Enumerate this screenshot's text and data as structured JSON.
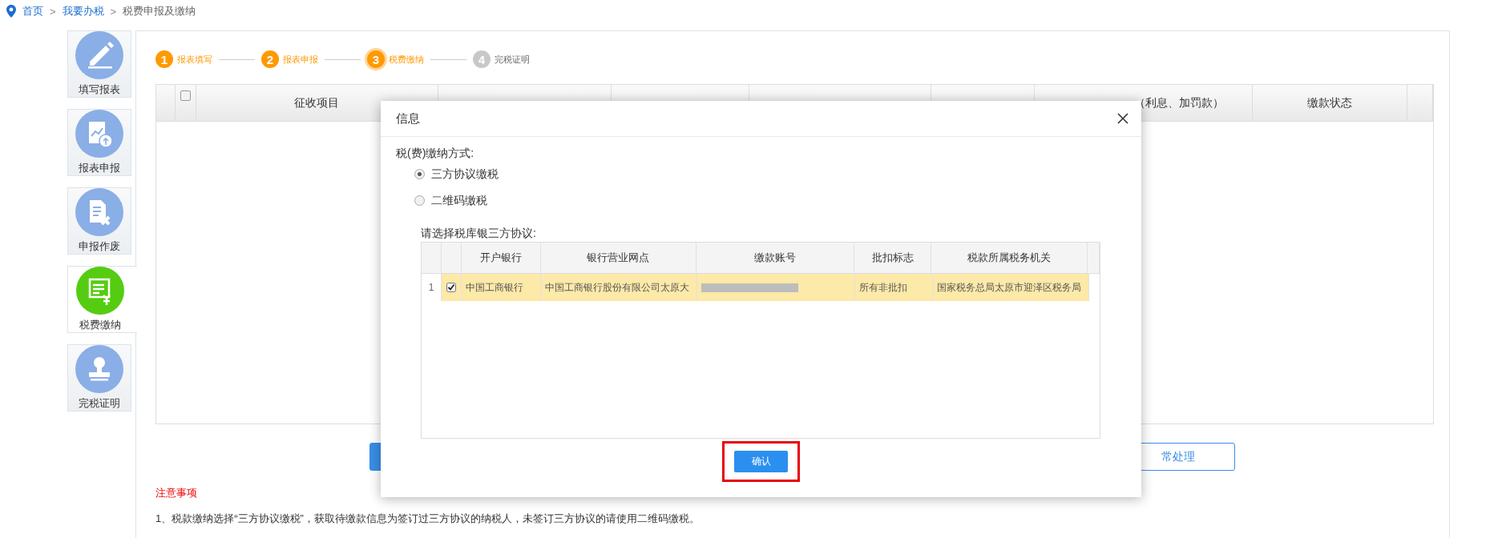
{
  "breadcrumb": [
    {
      "kind": "link",
      "label": "首页"
    },
    {
      "kind": "separator",
      "label": ">"
    },
    {
      "kind": "link",
      "label": "我要办税"
    },
    {
      "kind": "separator",
      "label": ">"
    },
    {
      "kind": "current",
      "label": "税费申报及缴纳"
    }
  ],
  "sidebar": {
    "items": [
      {
        "label": "填写报表",
        "selected": false
      },
      {
        "label": "报表申报",
        "selected": false
      },
      {
        "label": "申报作废",
        "selected": false
      },
      {
        "label": "税费缴纳",
        "selected": true
      },
      {
        "label": "完税证明",
        "selected": false
      }
    ]
  },
  "stepper": {
    "steps": [
      {
        "number": "1",
        "label": "报表填写",
        "done": true,
        "selected": false
      },
      {
        "number": "2",
        "label": "报表申报",
        "done": true,
        "selected": false
      },
      {
        "number": "3",
        "label": "税费缴纳",
        "done": false,
        "selected": true
      },
      {
        "number": "4",
        "label": "完税证明",
        "done": false,
        "selected": false
      }
    ]
  },
  "table": {
    "columns": [
      {
        "kind": "blank"
      },
      {
        "kind": "checkbox",
        "checked": false
      },
      {
        "kind": "text",
        "label": "征收项目"
      },
      {
        "kind": "covered"
      },
      {
        "kind": "covered"
      },
      {
        "kind": "covered"
      },
      {
        "kind": "covered"
      },
      {
        "kind": "text",
        "label": "（利息、加罚款）"
      },
      {
        "kind": "text",
        "label": "缴款状态"
      },
      {
        "kind": "blank"
      }
    ]
  },
  "actions": [
    {
      "kind": "primary"
    },
    {
      "kind": "outline",
      "label": "常处理"
    }
  ],
  "notes": {
    "title": "注意事项",
    "lines": [
      "1、税款缴纳选择“三方协议缴税”，获取待缴款信息为签订过三方协议的纳税人，未签订三方协议的请使用二维码缴税。"
    ]
  },
  "dialog": {
    "title": "信息",
    "method_label": "税(费)缴纳方式:",
    "methods": [
      {
        "label": "三方协议缴税",
        "selected": true
      },
      {
        "label": "二维码缴税",
        "selected": false
      }
    ],
    "agreement_label": "请选择税库银三方协议:",
    "grid": {
      "columns": [
        {
          "kind": "text",
          "label": "开户银行"
        },
        {
          "kind": "text",
          "label": "银行营业网点"
        },
        {
          "kind": "text",
          "label": "缴款账号"
        },
        {
          "kind": "text",
          "label": "批扣标志"
        },
        {
          "kind": "text",
          "label": "税款所属税务机关"
        }
      ],
      "rows": [
        {
          "index": "1",
          "checked": true,
          "selected": true,
          "cells": [
            {
              "kind": "text",
              "text": "中国工商银行"
            },
            {
              "kind": "text",
              "text": "中国工商银行股份有限公司太原大"
            },
            {
              "kind": "masked"
            },
            {
              "kind": "text",
              "text": "所有非批扣"
            },
            {
              "kind": "text",
              "text": "国家税务总局太原市迎泽区税务局"
            }
          ]
        }
      ]
    },
    "confirm": {
      "label": "确认",
      "highlighted": true
    }
  }
}
